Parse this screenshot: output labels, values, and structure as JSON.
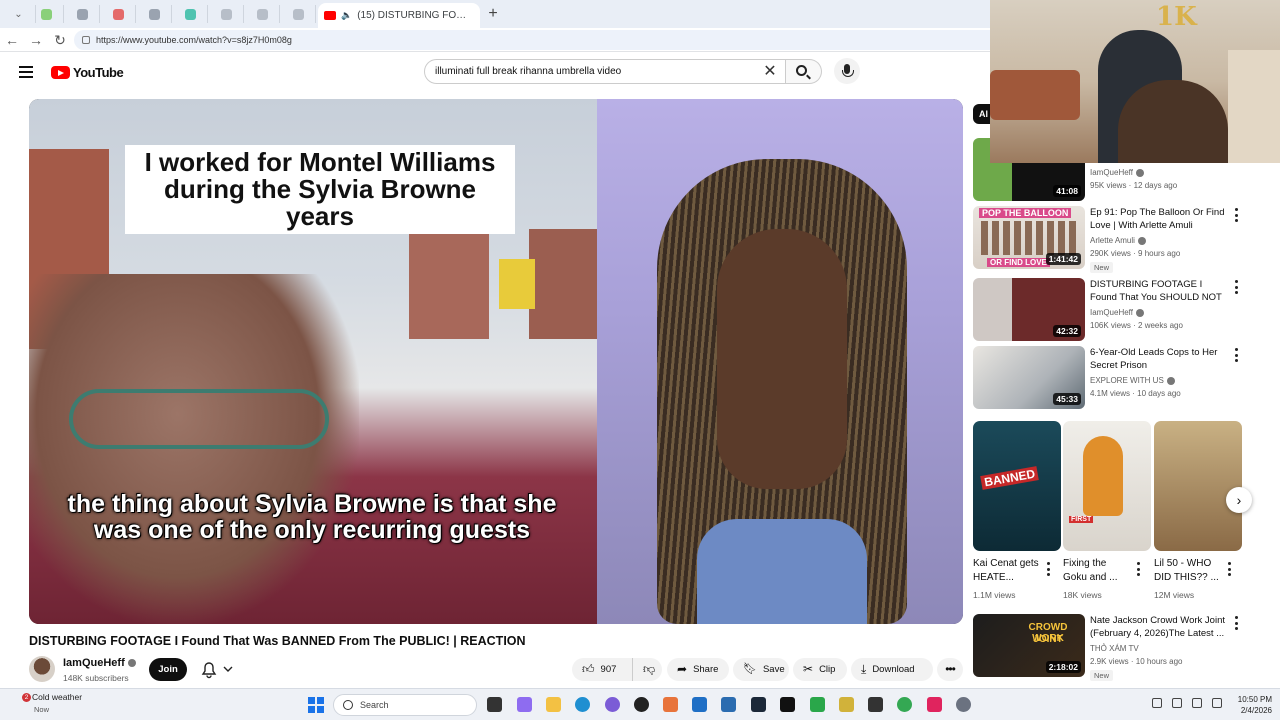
{
  "browser": {
    "active_tab_title": "(15) DISTURBING FOOTAGE I",
    "new_tab_label": "+",
    "url": "https://www.youtube.com/watch?v=s8jz7H0m08g"
  },
  "youtube": {
    "logo_text": "YouTube",
    "search_value": "illuminati full break rihanna umbrella video"
  },
  "video": {
    "caption_top": "I worked for Montel Williams during the Sylvia Browne years",
    "caption_bottom": "the thing about Sylvia Browne is that she was one of the only recurring guests",
    "title": "DISTURBING FOOTAGE I Found That Was BANNED From The PUBLIC! | REACTION",
    "channel": "IamQueHeff",
    "subscribers": "148K subscribers",
    "join_label": "Join",
    "likes": "907",
    "share_label": "Share",
    "save_label": "Save",
    "clip_label": "Clip",
    "download_label": "Download"
  },
  "sidebar": {
    "chip_label": "Al",
    "items": [
      {
        "title": "",
        "channel": "IamQueHeff",
        "meta": "95K views · 12 days ago",
        "duration": "41:08"
      },
      {
        "title": "Ep 91: Pop The Balloon Or Find Love | With Arlette Amuli",
        "channel": "Arlette Amuli",
        "meta": "290K views · 9 hours ago",
        "duration": "1:41:42",
        "badge": "New",
        "thumb_text_1": "POP THE BALLOON",
        "thumb_text_2": "OR FIND LOVE"
      },
      {
        "title": "DISTURBING FOOTAGE I Found That You SHOULD NOT WATC...",
        "channel": "IamQueHeff",
        "meta": "106K views · 2 weeks ago",
        "duration": "42:32"
      },
      {
        "title": "6-Year-Old Leads Cops to Her Secret Prison",
        "channel": "EXPLORE WITH US",
        "meta": "4.1M views · 10 days ago",
        "duration": "45:33"
      },
      {
        "title": "Nate Jackson Crowd Work Joint (February 4, 2026)The Latest ...",
        "channel": "THỎ XÁM TV",
        "meta": "2.9K views · 10 hours ago",
        "duration": "2:18:02",
        "badge": "New",
        "thumb_text_1": "CROWD WORK",
        "thumb_text_2": "JOINT"
      }
    ],
    "shorts": [
      {
        "title": "Kai Cenat gets HEATE...",
        "views": "1.1M views",
        "overlay": "BANNED"
      },
      {
        "title": "Fixing the Goku and ...",
        "views": "18K views",
        "overlay": "FIRST"
      },
      {
        "title": "Lil 50 - WHO DID THIS?? ...",
        "views": "12M views",
        "overlay": ""
      }
    ],
    "next_arrow": "›"
  },
  "webcam": {
    "balloon_text": "1K"
  },
  "taskbar": {
    "weather_text": "Cold weather",
    "weather_sub": "Now",
    "weather_badge": "2",
    "search_placeholder": "Search",
    "time": "10:50 PM",
    "date": "2/4/2026"
  },
  "colors": {
    "youtube_red": "#ff0000",
    "accent_blue": "#1a73e8"
  }
}
